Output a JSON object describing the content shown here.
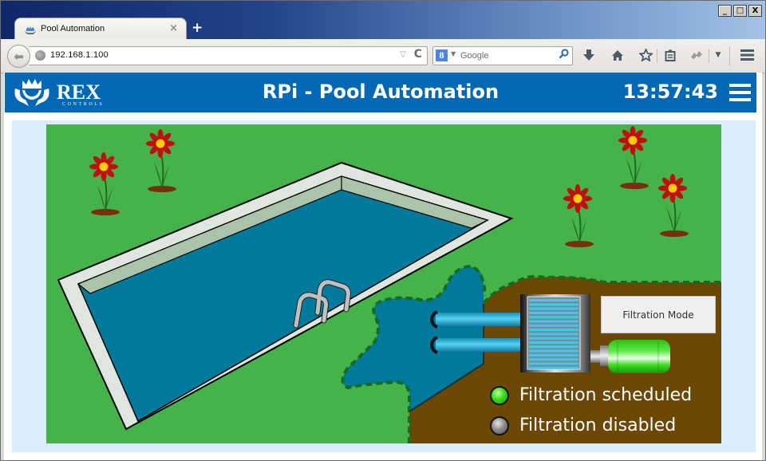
{
  "browser": {
    "window_controls": {
      "minimize": "_",
      "maximize": "□",
      "close": "X"
    },
    "tab": {
      "title": "Pool Automation",
      "close": "×"
    },
    "new_tab": "+",
    "url": "192.168.1.100",
    "search": {
      "engine": "8",
      "placeholder": "Google"
    },
    "icons": [
      "back-icon",
      "globe-icon",
      "dropdown-icon",
      "reload-icon",
      "search-engine-icon",
      "search-go-icon",
      "downloads-icon",
      "home-icon",
      "bookmark-star-icon",
      "reading-list-icon",
      "extension-icon",
      "overflow-dropdown-icon",
      "menu-icon"
    ]
  },
  "app": {
    "logo": {
      "name": "REX",
      "sub": "CONTROLS"
    },
    "title": "RPi - Pool Automation",
    "clock": "13:57:43"
  },
  "scene": {
    "colors": {
      "grass": "#46b34a",
      "water": "#007a9c",
      "soil": "#6b4702",
      "pool_rim": "#dfe6df",
      "pool_wall": "#abc3a8",
      "border_dash": "#176b1f"
    },
    "flowers": 5,
    "mode_button": "Filtration Mode",
    "status": [
      {
        "label": "Filtration scheduled",
        "state": "on",
        "color": "#3bdc18"
      },
      {
        "label": "Filtration disabled",
        "state": "off",
        "color": "#8d8d8d"
      }
    ]
  }
}
